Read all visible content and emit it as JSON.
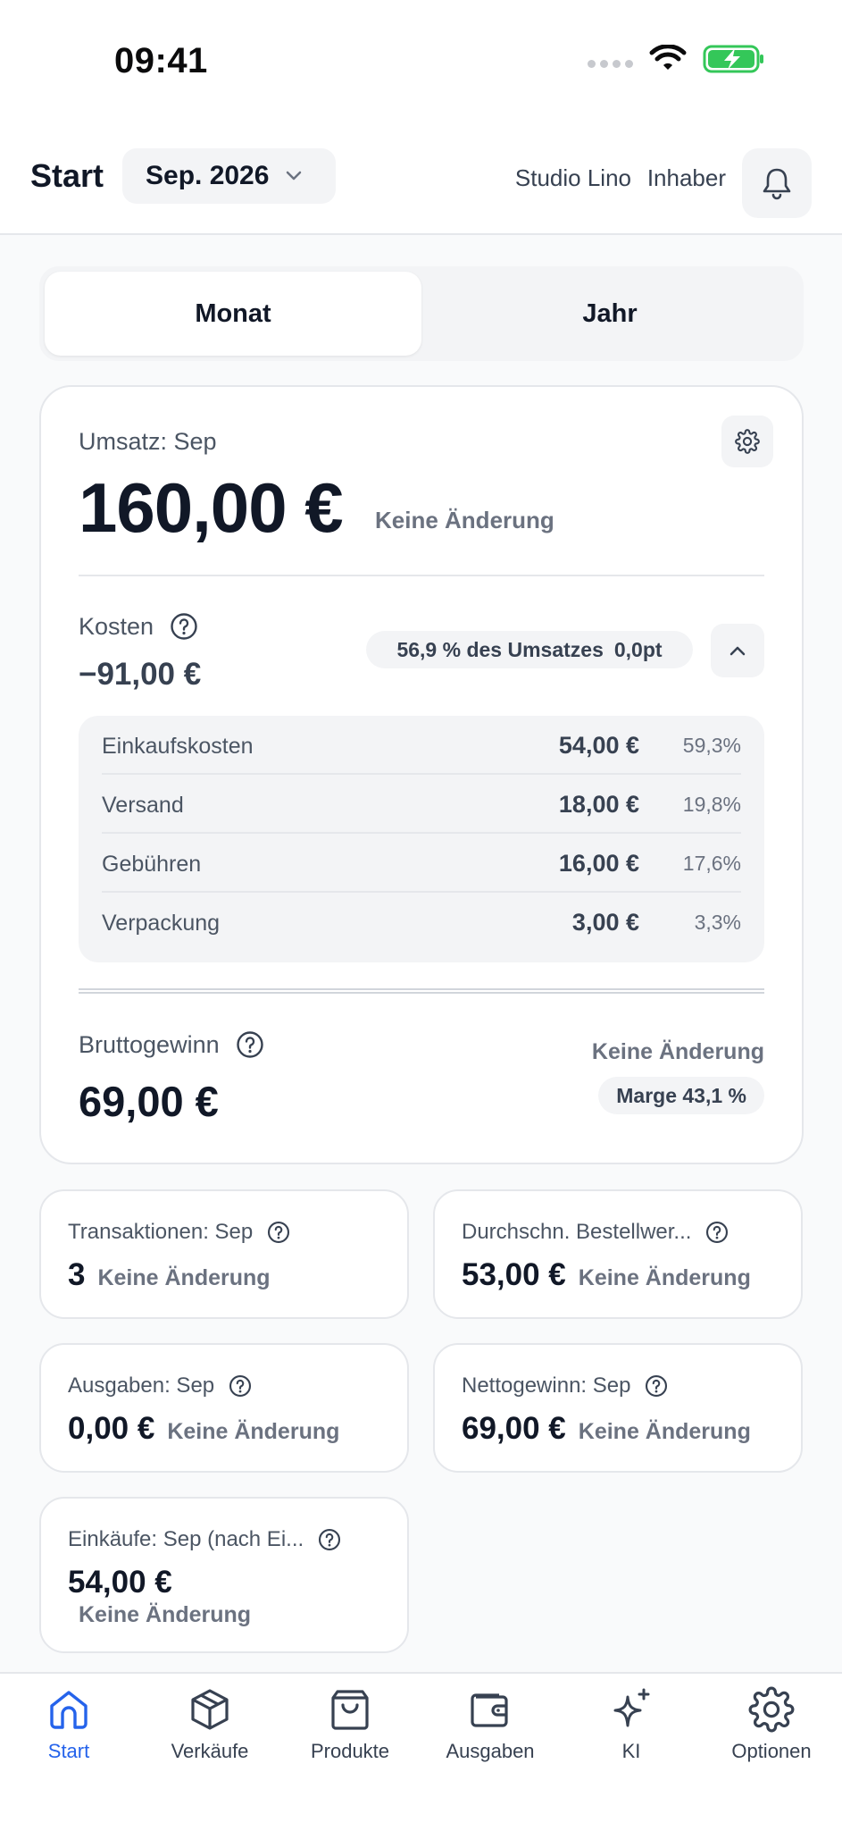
{
  "status_bar": {
    "time": "09:41"
  },
  "header": {
    "title": "Start",
    "month": "Sep. 2026",
    "shop": "Studio Lino",
    "role": "Inhaber"
  },
  "segments": {
    "active": "Monat",
    "inactive": "Jahr"
  },
  "revenue": {
    "label": "Umsatz: Sep",
    "value": "160,00 €",
    "change": "Keine Änderung"
  },
  "costs": {
    "label": "Kosten",
    "value": "−91,00 €",
    "share": "56,9 % des Umsatzes",
    "delta": "0,0pt",
    "items": [
      {
        "name": "Einkaufskosten",
        "amount": "54,00 €",
        "pct": "59,3%"
      },
      {
        "name": "Versand",
        "amount": "18,00 €",
        "pct": "19,8%"
      },
      {
        "name": "Gebühren",
        "amount": "16,00 €",
        "pct": "17,6%"
      },
      {
        "name": "Verpackung",
        "amount": "3,00 €",
        "pct": "3,3%"
      }
    ]
  },
  "gross": {
    "label": "Bruttogewinn",
    "value": "69,00 €",
    "change": "Keine Änderung",
    "margin": "Marge 43,1 %"
  },
  "kpis": [
    {
      "label": "Transaktionen: Sep",
      "value": "3",
      "change": "Keine Änderung"
    },
    {
      "label": "Durchschn. Bestellwer...",
      "value": "53,00 €",
      "change": "Keine Änderung"
    },
    {
      "label": "Ausgaben: Sep",
      "value": "0,00 €",
      "change": "Keine Änderung"
    },
    {
      "label": "Nettogewinn: Sep",
      "value": "69,00 €",
      "change": "Keine Änderung"
    },
    {
      "label": "Einkäufe: Sep (nach Ei...",
      "value": "54,00 €",
      "change": "Keine Änderung"
    }
  ],
  "tabs": [
    {
      "label": "Start"
    },
    {
      "label": "Verkäufe"
    },
    {
      "label": "Produkte"
    },
    {
      "label": "Ausgaben"
    },
    {
      "label": "KI"
    },
    {
      "label": "Optionen"
    }
  ],
  "colors": {
    "accent": "#2563eb",
    "battery": "#34c759",
    "text_primary": "#111827",
    "text_muted": "#6b7280",
    "background": "#f9fafb"
  }
}
